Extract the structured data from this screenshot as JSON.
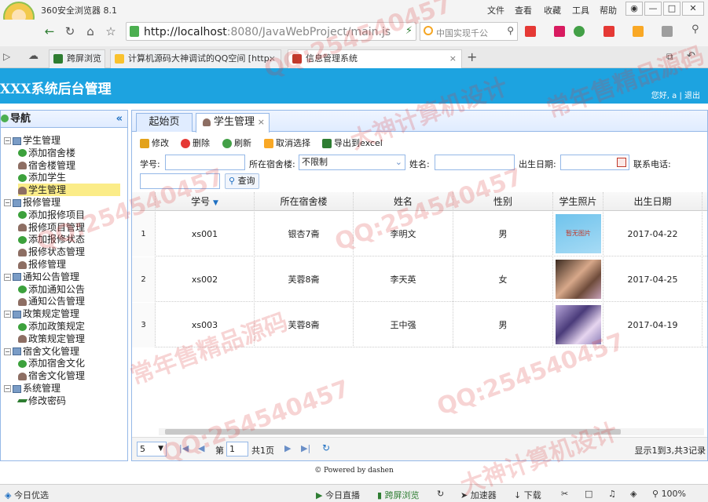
{
  "browser": {
    "title": "360安全浏览器 8.1",
    "menu": [
      "文件",
      "查看",
      "收藏",
      "工具",
      "帮助"
    ],
    "url_host": "http://localhost",
    "url_rest": ":8080/JavaWebProject/main.js",
    "search_placeholder": "中国实现千公",
    "tabs": [
      {
        "label": "跨屏浏览"
      },
      {
        "label": "计算机源码大神调试的QQ空间 [http:"
      },
      {
        "label": "信息管理系统"
      }
    ],
    "status": {
      "left": "今日优选",
      "live": "今日直播",
      "cross": "跨屏浏览",
      "speed": "加速器",
      "download": "下载",
      "zoom": "100%"
    }
  },
  "app": {
    "title": "XXX系统后台管理",
    "user_greeting": "您好, a",
    "logout": "退出",
    "footer": "© Powered by dashen"
  },
  "nav": {
    "header": "导航",
    "groups": [
      {
        "label": "学生管理",
        "items": [
          "添加宿舍楼",
          "宿舍楼管理",
          "添加学生",
          "学生管理"
        ]
      },
      {
        "label": "报修管理",
        "items": [
          "添加报修项目",
          "报修项目管理",
          "添加报修状态",
          "报修状态管理",
          "报修管理"
        ]
      },
      {
        "label": "通知公告管理",
        "items": [
          "添加通知公告",
          "通知公告管理"
        ]
      },
      {
        "label": "政策规定管理",
        "items": [
          "添加政策规定",
          "政策规定管理"
        ]
      },
      {
        "label": "宿舍文化管理",
        "items": [
          "添加宿舍文化",
          "宿舍文化管理"
        ]
      },
      {
        "label": "系统管理",
        "items": [
          "修改密码"
        ]
      }
    ]
  },
  "main": {
    "tabs": [
      "起始页",
      "学生管理"
    ],
    "toolbar": {
      "edit": "修改",
      "delete": "删除",
      "refresh": "刷新",
      "unselect": "取消选择",
      "export": "导出到excel"
    },
    "filters": {
      "student_no": "学号:",
      "building": "所在宿舍楼:",
      "building_value": "不限制",
      "name": "姓名:",
      "birth": "出生日期:",
      "phone": "联系电话:",
      "search": "查询"
    },
    "columns": [
      "学号",
      "所在宿舍楼",
      "姓名",
      "性别",
      "学生照片",
      "出生日期"
    ],
    "rows": [
      {
        "num": "1",
        "no": "xs001",
        "building": "银杏7斋",
        "name": "李明文",
        "gender": "男",
        "photo": "暂无图片",
        "birth": "2017-04-22"
      },
      {
        "num": "2",
        "no": "xs002",
        "building": "芙蓉8斋",
        "name": "李天英",
        "gender": "女",
        "photo": "",
        "birth": "2017-04-25"
      },
      {
        "num": "3",
        "no": "xs003",
        "building": "芙蓉8斋",
        "name": "王中强",
        "gender": "男",
        "photo": "",
        "birth": "2017-04-19"
      }
    ],
    "pager": {
      "page_size": "5",
      "page_prefix": "第",
      "page_value": "1",
      "page_suffix": "共1页",
      "summary": "显示1到3,共3记录"
    }
  },
  "watermarks": [
    "QQ:254540457",
    "常年售精品源码",
    "大神计算机设计"
  ]
}
